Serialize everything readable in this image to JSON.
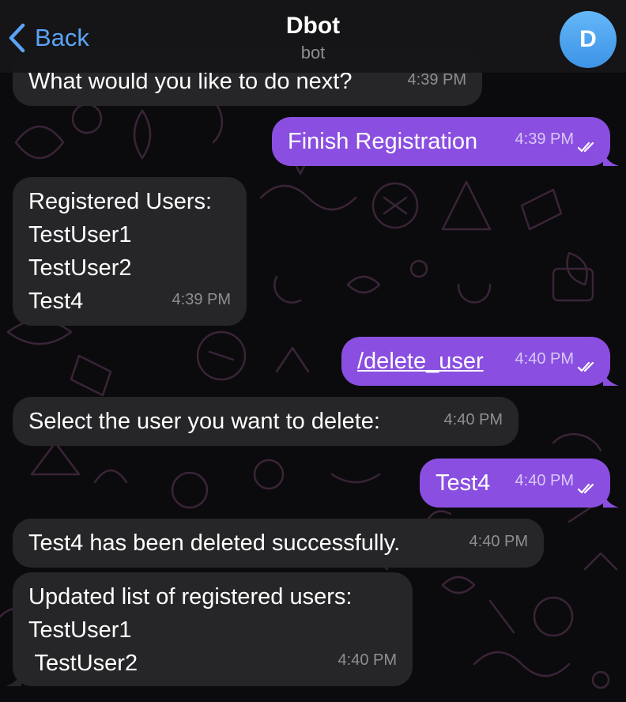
{
  "header": {
    "back_label": "Back",
    "title": "Dbot",
    "subtitle": "bot",
    "avatar_initial": "D"
  },
  "messages": [
    {
      "from": "bot",
      "lines": [
        "What would you like to do next?"
      ],
      "time": "4:39 PM"
    },
    {
      "from": "user",
      "lines": [
        "Finish Registration"
      ],
      "time": "4:39 PM",
      "read": true
    },
    {
      "from": "bot",
      "lines": [
        "Registered Users:",
        "TestUser1",
        "TestUser2",
        "Test4"
      ],
      "time": "4:39 PM"
    },
    {
      "from": "user",
      "lines": [
        "/delete_user"
      ],
      "time": "4:40 PM",
      "read": true,
      "is_command": true
    },
    {
      "from": "bot",
      "lines": [
        "Select the user you want to delete:"
      ],
      "time": "4:40 PM"
    },
    {
      "from": "user",
      "lines": [
        "Test4"
      ],
      "time": "4:40 PM",
      "read": true
    },
    {
      "from": "bot",
      "lines": [
        "Test4 has been deleted successfully."
      ],
      "time": "4:40 PM"
    },
    {
      "from": "bot",
      "lines": [
        "Updated list of registered users:",
        "TestUser1",
        " TestUser2"
      ],
      "time": "4:40 PM"
    }
  ],
  "colors": {
    "accent": "#5ba4f5",
    "incoming_bubble": "#262628",
    "outgoing_bubble": "#8a4fe0",
    "wallpaper_doodle": "#3a2438"
  },
  "icons": {
    "back": "chevron-left-icon",
    "read_receipt": "double-check-icon"
  }
}
